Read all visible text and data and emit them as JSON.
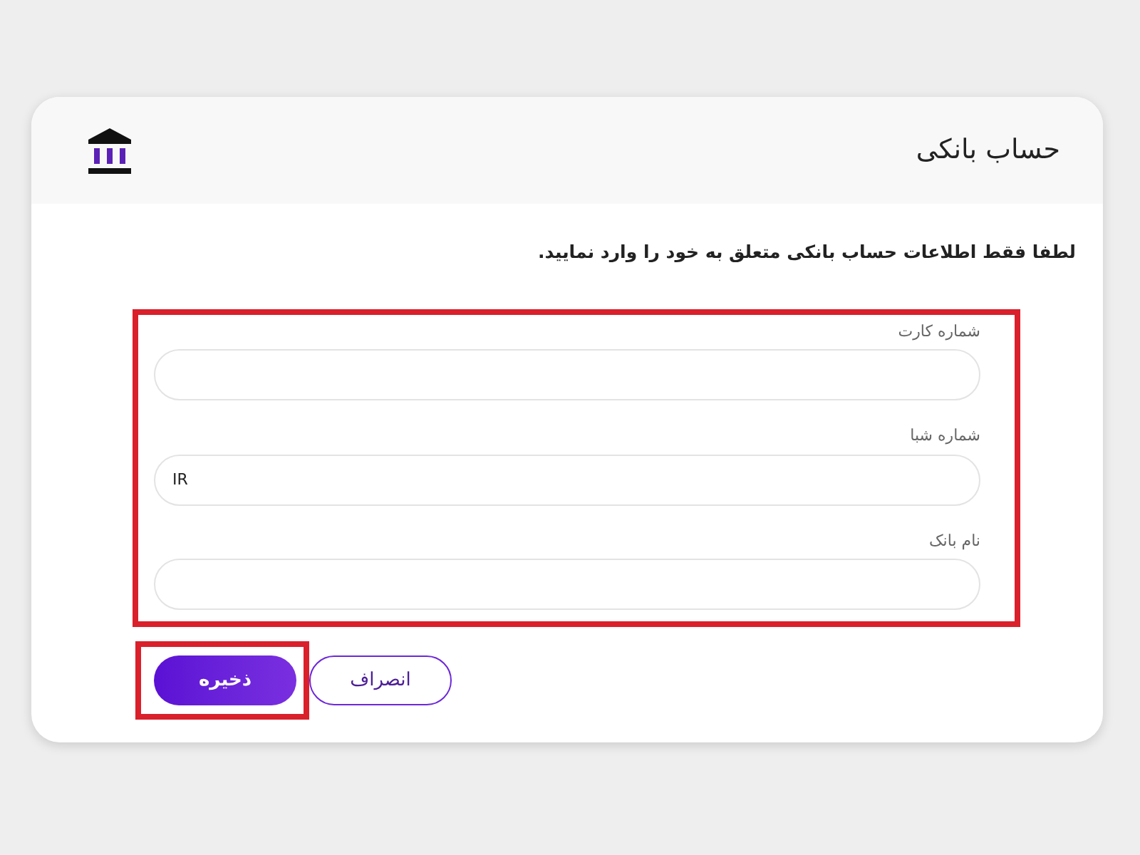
{
  "header": {
    "title": "حساب بانکی"
  },
  "instruction": "لطفا فقط اطلاعات حساب بانکی متعلق به خود را وارد نمایید.",
  "form": {
    "highlighted": true,
    "fields": [
      {
        "label": "شماره کارت"
      },
      {
        "label": "شماره شبا",
        "value": "IR"
      },
      {
        "label": "نام بانک"
      }
    ]
  },
  "buttons": [
    {
      "label": "انصراف",
      "kind": "secondary",
      "highlighted": false
    },
    {
      "label": "ذخیره",
      "kind": "primary",
      "highlighted": true
    }
  ]
}
